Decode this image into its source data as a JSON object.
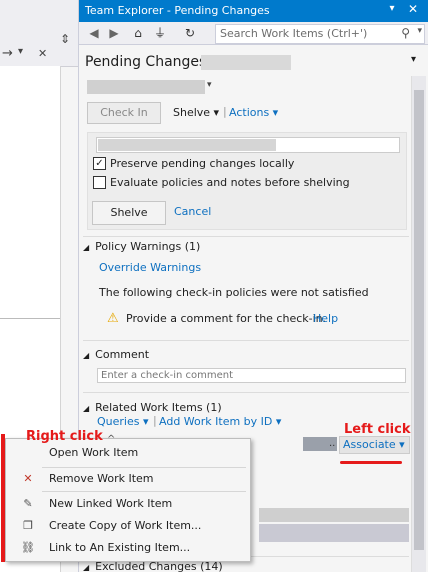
{
  "editor": {
    "arrow_glyph": "→",
    "dropdown_glyph": "▾",
    "close_glyph": "✕",
    "splitter_glyph": "⇕"
  },
  "window": {
    "title": "Team Explorer - Pending Changes",
    "pin_glyph": "▾",
    "close_glyph": "✕"
  },
  "toolbar": {
    "back_glyph": "◀",
    "forward_glyph": "▶",
    "home_glyph": "⌂",
    "connect_glyph": "⏚",
    "refresh_glyph": "↻",
    "search_placeholder": "Search Work Items (Ctrl+')",
    "search_glyph": "⚲",
    "search_drop_glyph": "▾"
  },
  "header": {
    "title": "Pending Changes",
    "menu_glyph": "▾",
    "workspace_drop_glyph": "▾"
  },
  "checkin": {
    "checkin_label": "Check In",
    "shelve_label": "Shelve ▾",
    "separator": "|",
    "actions_label": "Actions ▾"
  },
  "shelve": {
    "preserve_label": "Preserve pending changes locally",
    "preserve_checked": true,
    "preserve_glyph": "✓",
    "evaluate_label": "Evaluate policies and notes before shelving",
    "evaluate_checked": false,
    "shelve_button": "Shelve",
    "cancel_link": "Cancel"
  },
  "policy": {
    "header": "Policy Warnings (1)",
    "override_link": "Override Warnings",
    "message": "The following check-in policies were not satisfied",
    "warning_glyph": "⚠",
    "warning_text": "Provide a comment for the check-in.",
    "help_link": "Help"
  },
  "comment": {
    "header": "Comment",
    "placeholder": "Enter a check-in comment"
  },
  "related": {
    "header": "Related Work Items (1)",
    "queries_label": "Queries ▾",
    "separator": "|",
    "add_by_id_label": "Add Work Item by ID ▾",
    "caret": "^",
    "ellipsis": "..",
    "associate_label": "Associate ▾"
  },
  "excluded": {
    "header": "Excluded Changes (14)"
  },
  "section_glyph": "◢",
  "context_menu": {
    "items": [
      {
        "label": "Open Work Item",
        "icon": ""
      },
      {
        "label": "Remove Work Item",
        "icon": "✕"
      },
      {
        "label": "New Linked Work Item",
        "icon": "✎"
      },
      {
        "label": "Create Copy of Work Item...",
        "icon": "❐"
      },
      {
        "label": "Link to An Existing Item...",
        "icon": "⛓"
      }
    ]
  },
  "annotations": {
    "right_click": "Right click",
    "left_click": "Left click",
    "color": "#e51a1a"
  },
  "colors": {
    "title_bar": "#007acc",
    "link": "#0e70c0"
  }
}
